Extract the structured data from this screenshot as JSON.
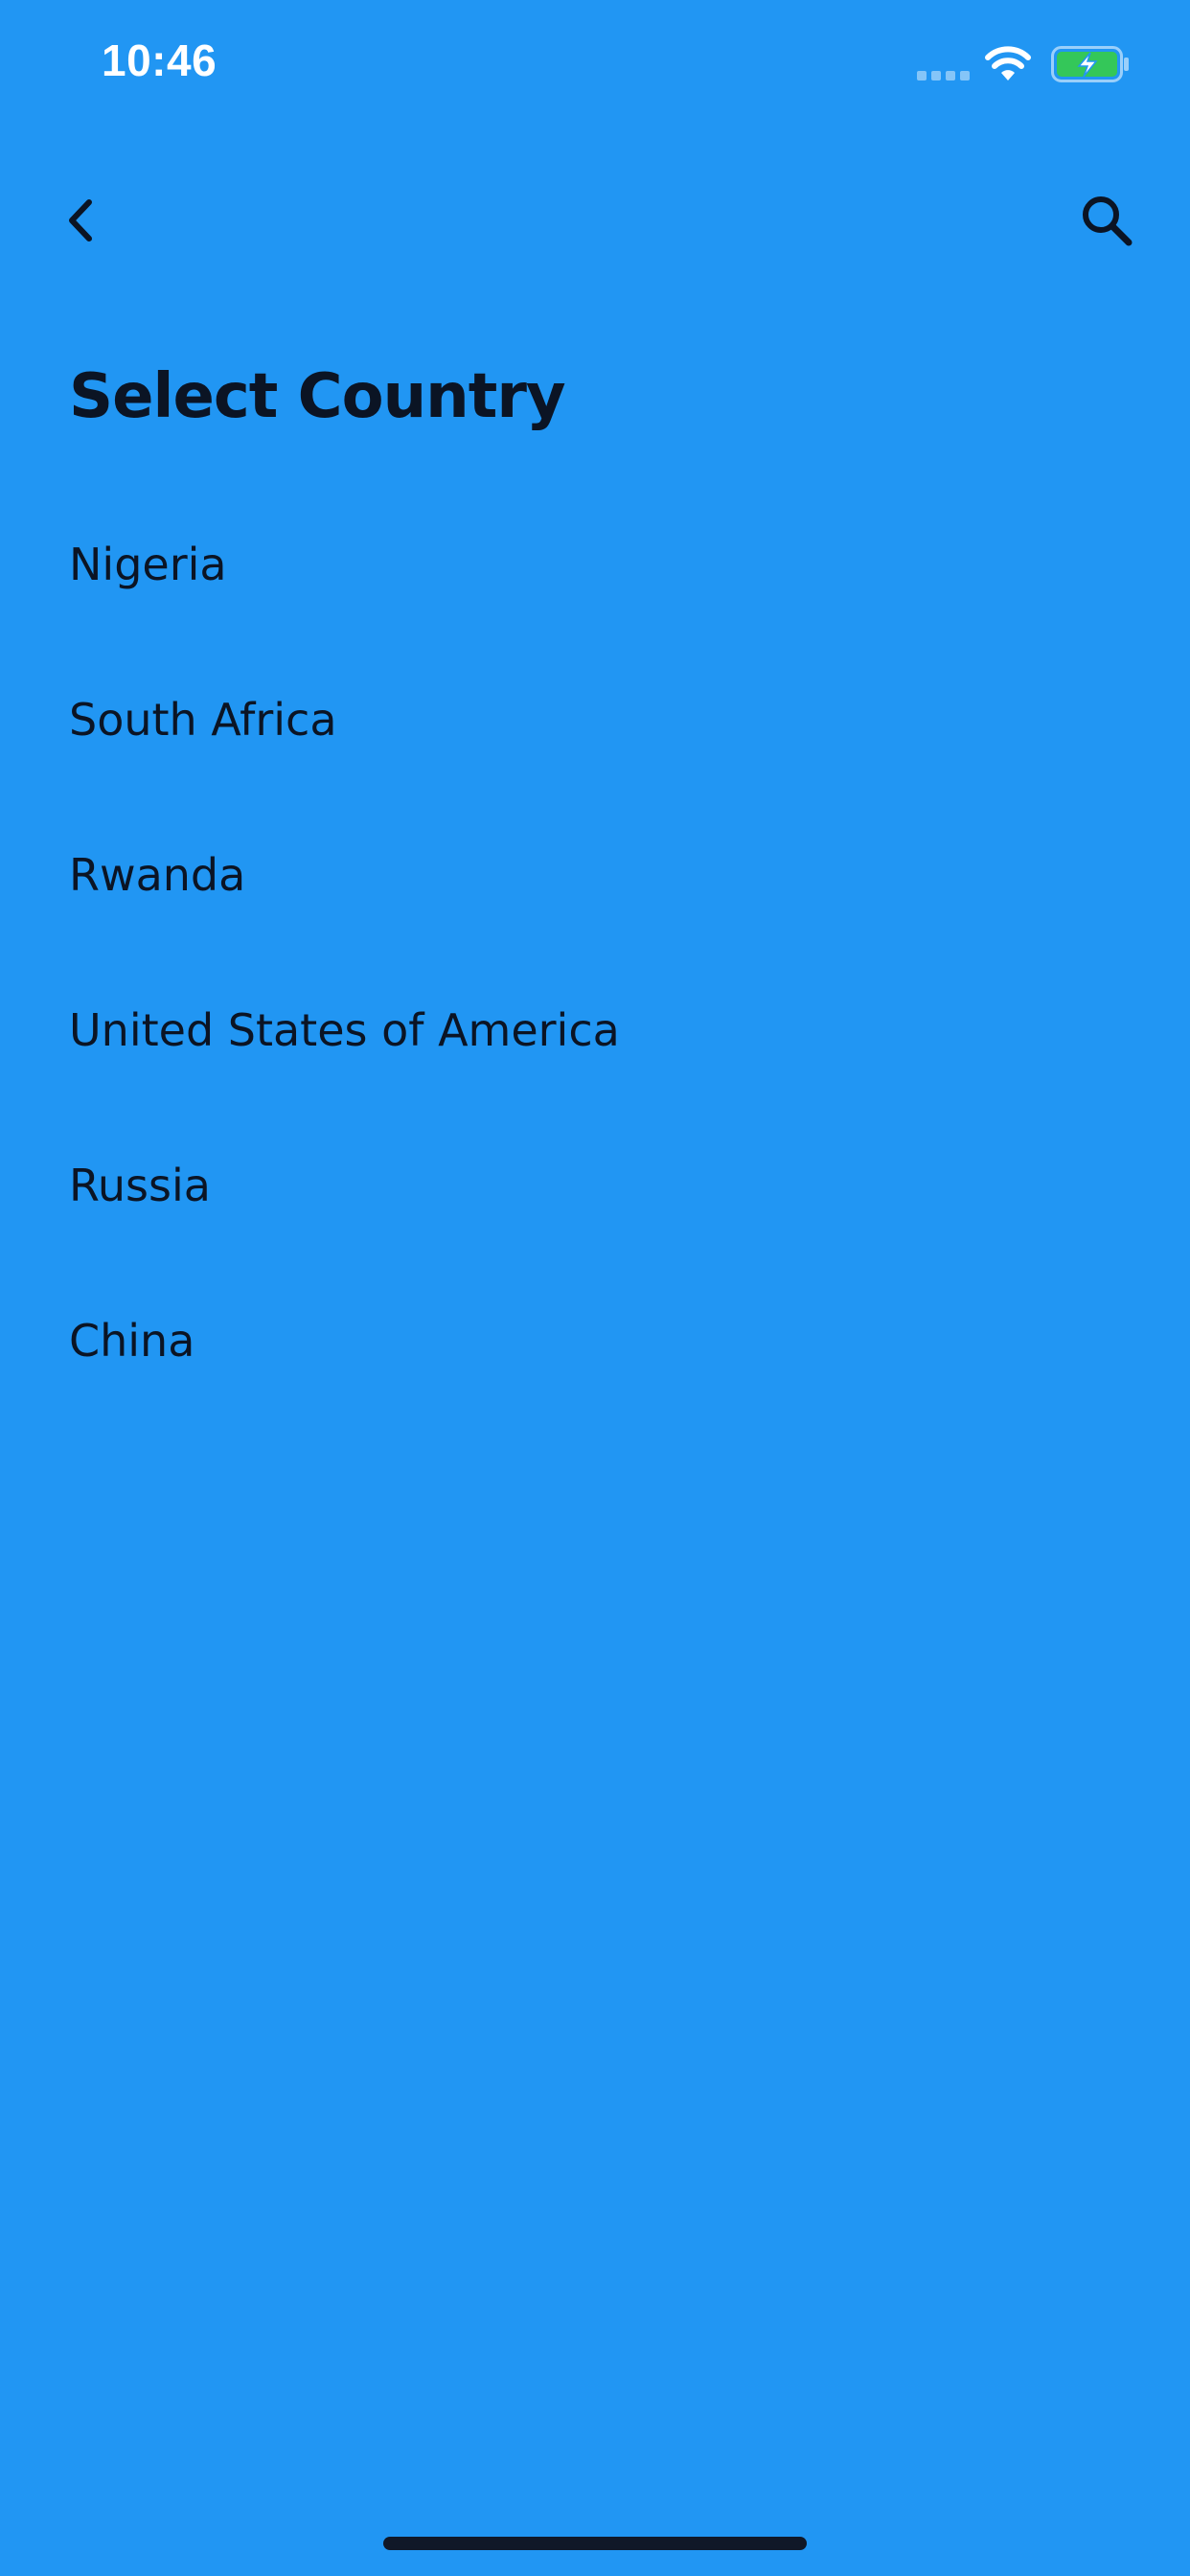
{
  "status_bar": {
    "time": "10:46"
  },
  "header": {
    "title": "Select Country"
  },
  "countries": [
    {
      "label": "Nigeria"
    },
    {
      "label": "South Africa"
    },
    {
      "label": "Rwanda"
    },
    {
      "label": "United States of America"
    },
    {
      "label": "Russia"
    },
    {
      "label": "China"
    }
  ],
  "icons": {
    "back": "chevron-left-icon",
    "search": "search-icon",
    "wifi": "wifi-icon",
    "battery": "battery-charging-icon",
    "signal": "cellular-signal-icon"
  },
  "colors": {
    "background": "#2196F3",
    "text": "#0B1424",
    "status_text": "#FFFFFF",
    "battery_fill": "#34C759"
  }
}
